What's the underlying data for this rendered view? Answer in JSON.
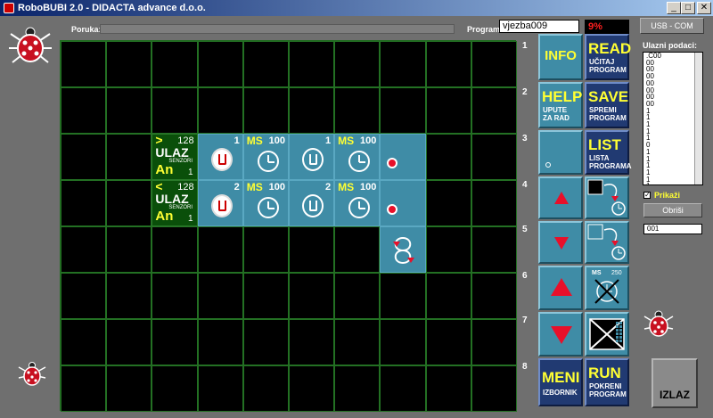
{
  "window": {
    "title": "RoboBUBI 2.0 - DIDACTA advance d.o.o.",
    "min": "_",
    "max": "□",
    "close": "✕"
  },
  "header": {
    "poruka_label": "Poruka:",
    "program_label": "Program:",
    "program_value": "vjezba009",
    "percent": "9%",
    "usb_label": "USB - COM"
  },
  "grid": {
    "row3": {
      "input": {
        "sym": ">",
        "num": "128",
        "ulaz": "ULAZ",
        "senzori": "SENZORI",
        "an": "An",
        "n": "1"
      },
      "c3": "1",
      "c4_ms": "MS",
      "c4_val": "100",
      "c5": "1",
      "c6_ms": "MS",
      "c6_val": "100"
    },
    "row4": {
      "input": {
        "sym": "<",
        "num": "128",
        "ulaz": "ULAZ",
        "senzori": "SENZORI",
        "an": "An",
        "n": "1"
      },
      "c3": "2",
      "c4_ms": "MS",
      "c4_val": "100",
      "c5": "2",
      "c6_ms": "MS",
      "c6_val": "100"
    }
  },
  "rownums": [
    "1",
    "2",
    "3",
    "4",
    "5",
    "6",
    "7",
    "8"
  ],
  "buttons": {
    "info": "INFO",
    "read": "READ",
    "read_sub1": "UČITAJ",
    "read_sub2": "PROGRAM",
    "help": "HELP",
    "help_sub1": "UPUTE",
    "help_sub2": "ZA RAD",
    "save": "SAVE",
    "save_sub1": "SPREMI",
    "save_sub2": "PROGRAM",
    "list": "LIST",
    "list_sub1": "LISTA",
    "list_sub2": "PROGRAMA",
    "ms_label": "MS",
    "ms_val": "250",
    "meni": "MENI",
    "meni_sub": "IZBORNIK",
    "run": "RUN",
    "run_sub1": "POKRENI",
    "run_sub2": "PROGRAM"
  },
  "right_panel": {
    "ulazni_label": "Ulazni podaci:",
    "values": [
      ".C00",
      "00",
      "00",
      "00",
      "00",
      "00",
      "00",
      "00",
      "1",
      "1",
      "1",
      "1",
      "1",
      "0",
      "1",
      "1",
      "1",
      "1",
      "1",
      "1"
    ],
    "check_mark": "✓",
    "prikazi": "Prikaži",
    "obrisi": "Obriši",
    "field_value": "001",
    "izlaz": "IZLAZ"
  },
  "colors": {
    "panel_blue": "#3f8ca6",
    "dark_blue": "#213a72",
    "accent_yellow": "#ffff33",
    "red": "#e8102a"
  }
}
